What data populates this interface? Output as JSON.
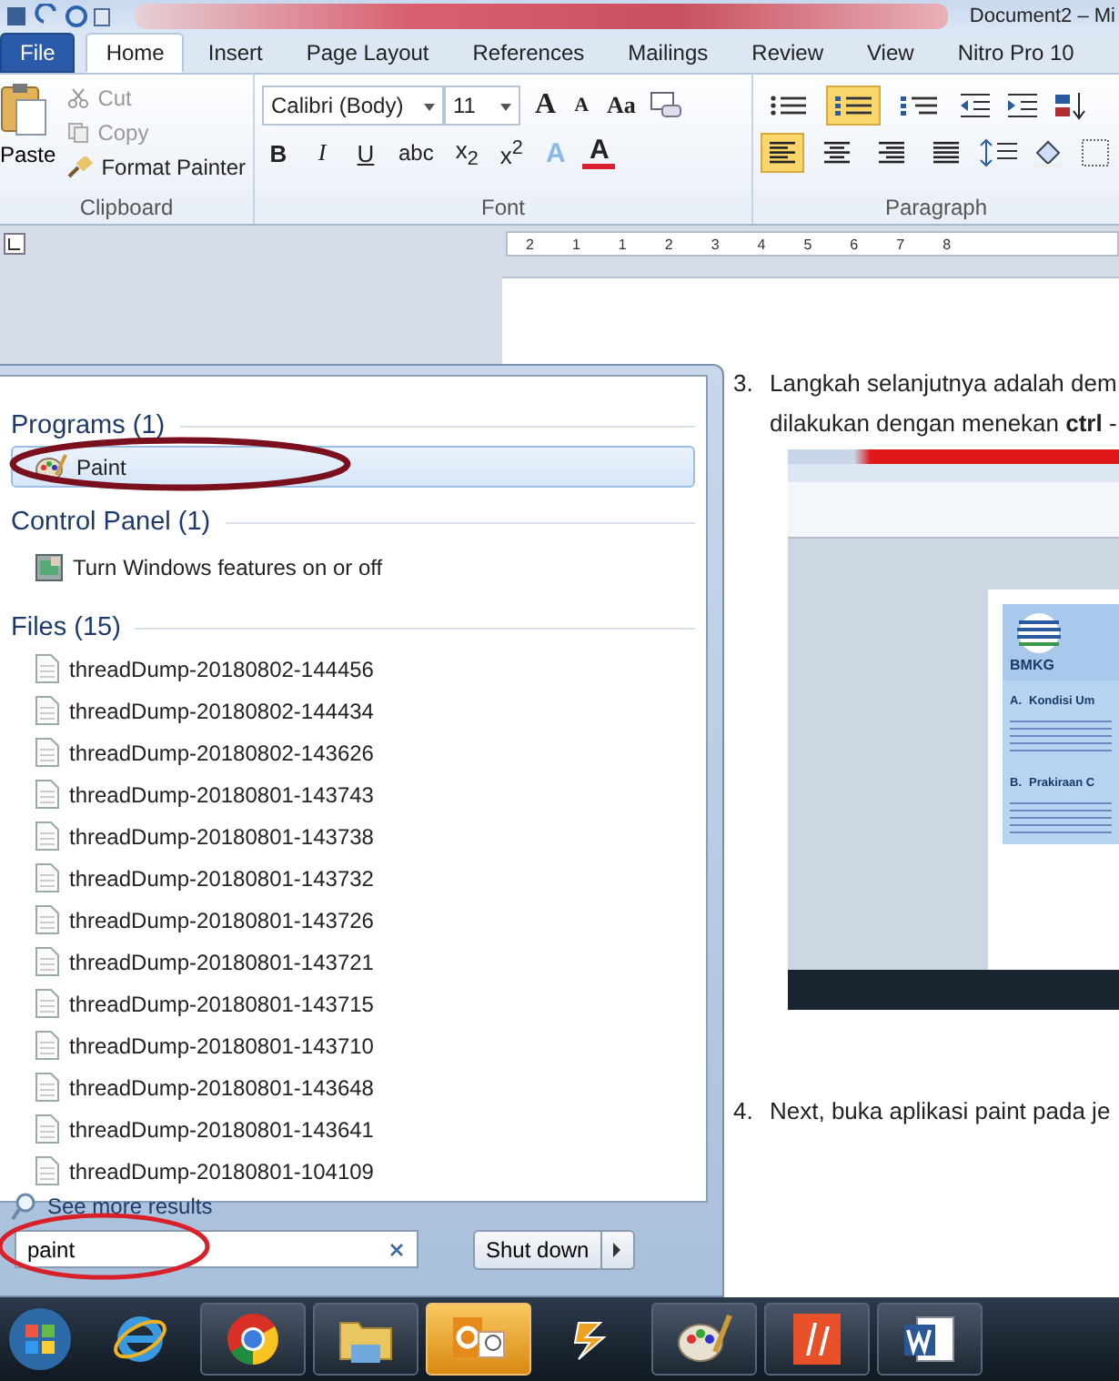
{
  "title_bar": {
    "title": "Document2 – Mi"
  },
  "ribbon_tabs": [
    {
      "label": "File",
      "kind": "file",
      "selected": false
    },
    {
      "label": "Home",
      "kind": "tab",
      "selected": true
    },
    {
      "label": "Insert",
      "kind": "tab",
      "selected": false
    },
    {
      "label": "Page Layout",
      "kind": "tab",
      "selected": false
    },
    {
      "label": "References",
      "kind": "tab",
      "selected": false
    },
    {
      "label": "Mailings",
      "kind": "tab",
      "selected": false
    },
    {
      "label": "Review",
      "kind": "tab",
      "selected": false
    },
    {
      "label": "View",
      "kind": "tab",
      "selected": false
    },
    {
      "label": "Nitro Pro 10",
      "kind": "tab",
      "selected": false
    }
  ],
  "clipboard": {
    "paste": "Paste",
    "cut": "Cut",
    "copy": "Copy",
    "format_painter": "Format Painter",
    "group": "Clipboard"
  },
  "font": {
    "family": "Calibri (Body)",
    "size": "11",
    "grow": "A",
    "shrink": "A",
    "change_case": "Aa",
    "group": "Font",
    "buttons": [
      {
        "label": "B",
        "kind": "bold"
      },
      {
        "label": "I",
        "kind": "italic"
      },
      {
        "label": "U",
        "kind": "underline"
      },
      {
        "label": "abc",
        "kind": "strike"
      },
      {
        "label": "x$_{2}$",
        "kind": "plain"
      },
      {
        "label": "x$^{2}$",
        "kind": "plain"
      },
      {
        "label": "A",
        "kind": "effects"
      },
      {
        "label": "A",
        "kind": "color"
      }
    ]
  },
  "paragraph": {
    "group": "Paragraph",
    "lists": [
      {
        "kind": "bullets",
        "selected": false
      },
      {
        "kind": "numbering",
        "selected": true
      },
      {
        "kind": "multilevel",
        "selected": false
      }
    ],
    "align": [
      {
        "kind": "left",
        "selected": true
      },
      {
        "kind": "center",
        "selected": false
      },
      {
        "kind": "right",
        "selected": false
      },
      {
        "kind": "justify",
        "selected": false
      }
    ]
  },
  "ruler": [
    "2",
    "1",
    "1",
    "2",
    "3",
    "4",
    "5",
    "6",
    "7",
    "8"
  ],
  "document": {
    "steps": [
      {
        "number": "3.",
        "lines": [
          "Langkah selanjutnya adalah dem",
          "dilakukan dengan menekan **ctrl** -"
        ],
        "screenshot": true
      },
      {
        "number": "4.",
        "lines": [
          "Next, buka aplikasi paint pada je"
        ],
        "screenshot": false
      }
    ],
    "embedded_screenshot": {
      "logo": "BMKG",
      "headings": [
        {
          "number": "A.",
          "text": "Kondisi Um"
        },
        {
          "number": "B.",
          "text": "Prakiraan C"
        }
      ]
    }
  },
  "start_menu": {
    "sections": [
      {
        "heading": "Programs (1)",
        "items": [
          {
            "label": "Paint",
            "kind": "paint",
            "selected": true
          }
        ]
      },
      {
        "heading": "Control Panel (1)",
        "items": [
          {
            "label": "Turn Windows features on or off",
            "kind": "control",
            "selected": false
          }
        ]
      },
      {
        "heading": "Files (15)",
        "items": [
          {
            "label": "threadDump-20180802-144456",
            "kind": "file",
            "selected": false
          },
          {
            "label": "threadDump-20180802-144434",
            "kind": "file",
            "selected": false
          },
          {
            "label": "threadDump-20180802-143626",
            "kind": "file",
            "selected": false
          },
          {
            "label": "threadDump-20180801-143743",
            "kind": "file",
            "selected": false
          },
          {
            "label": "threadDump-20180801-143738",
            "kind": "file",
            "selected": false
          },
          {
            "label": "threadDump-20180801-143732",
            "kind": "file",
            "selected": false
          },
          {
            "label": "threadDump-20180801-143726",
            "kind": "file",
            "selected": false
          },
          {
            "label": "threadDump-20180801-143721",
            "kind": "file",
            "selected": false
          },
          {
            "label": "threadDump-20180801-143715",
            "kind": "file",
            "selected": false
          },
          {
            "label": "threadDump-20180801-143710",
            "kind": "file",
            "selected": false
          },
          {
            "label": "threadDump-20180801-143648",
            "kind": "file",
            "selected": false
          },
          {
            "label": "threadDump-20180801-143641",
            "kind": "file",
            "selected": false
          },
          {
            "label": "threadDump-20180801-104109",
            "kind": "file",
            "selected": false
          }
        ]
      }
    ],
    "see_more": "See more results",
    "search": {
      "value": "paint"
    },
    "shutdown": "Shut down"
  },
  "taskbar": [
    {
      "kind": "start",
      "running": false,
      "active": false
    },
    {
      "kind": "ie",
      "running": false,
      "active": false
    },
    {
      "kind": "chrome",
      "running": true,
      "active": false
    },
    {
      "kind": "explorer",
      "running": true,
      "active": false
    },
    {
      "kind": "outlook",
      "running": true,
      "active": true
    },
    {
      "kind": "winamp",
      "running": false,
      "active": false
    },
    {
      "kind": "paint",
      "running": true,
      "active": false
    },
    {
      "kind": "nitro",
      "running": true,
      "active": false
    },
    {
      "kind": "word",
      "running": true,
      "active": false
    }
  ]
}
